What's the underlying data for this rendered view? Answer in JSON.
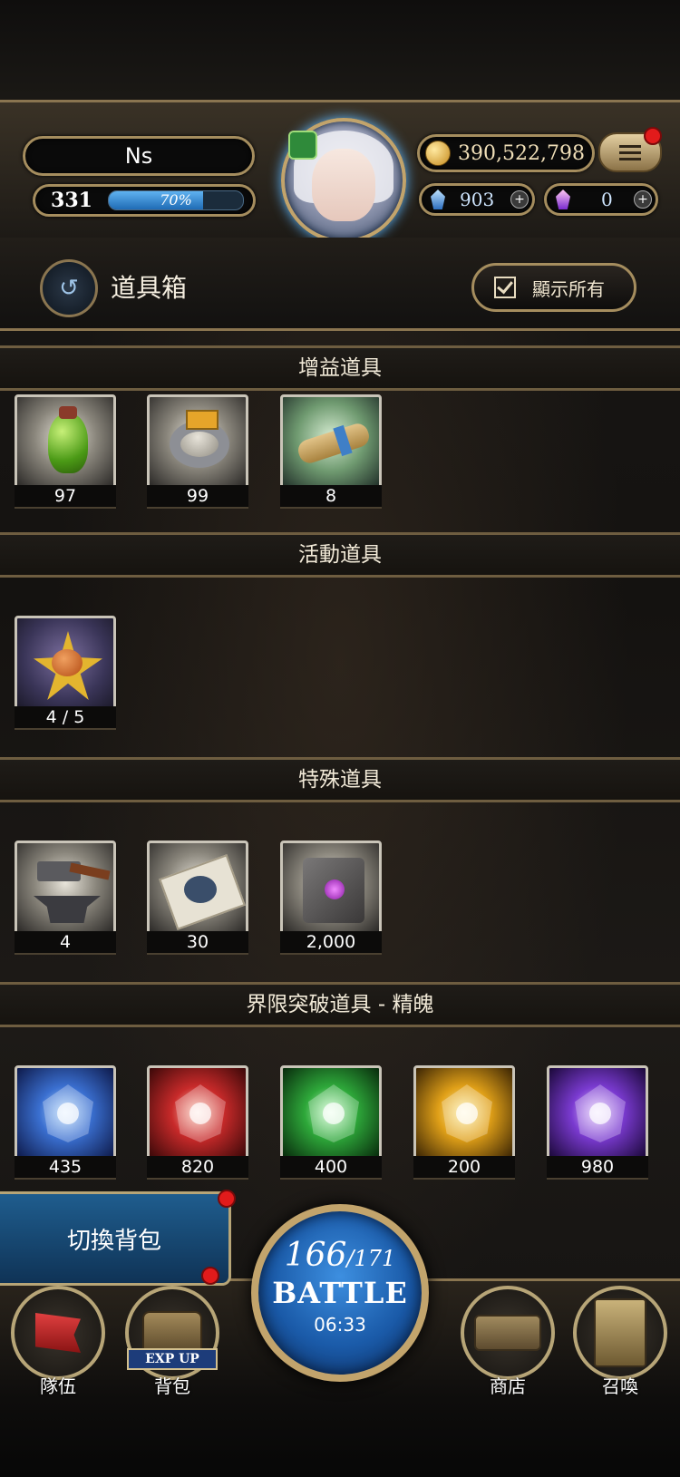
{
  "player": {
    "name": "Ns",
    "level": "331",
    "exp_text": "70%",
    "exp_percent": 70
  },
  "currency": {
    "gold": "390,522,798",
    "blue_gem": "903",
    "purple_gem": "0",
    "plus_symbol": "+"
  },
  "header": {
    "title": "道具箱",
    "show_all_label": "顯示所有",
    "back_icon": "↺"
  },
  "sections": [
    {
      "title": "增益道具",
      "items": [
        {
          "name": "green-potion-icon",
          "count": "97"
        },
        {
          "name": "silver-ring-icon",
          "count": "99"
        },
        {
          "name": "scroll-icon",
          "count": "8"
        }
      ]
    },
    {
      "title": "活動道具",
      "items": [
        {
          "name": "golden-star-icon",
          "count": "4 / 5"
        }
      ]
    },
    {
      "title": "特殊道具",
      "items": [
        {
          "name": "hammer-anvil-icon",
          "count": "4"
        },
        {
          "name": "ticket-icon",
          "count": "30"
        },
        {
          "name": "stone-cube-icon",
          "count": "2,000"
        }
      ]
    },
    {
      "title": "界限突破道具 - 精魄",
      "items": [
        {
          "name": "blue-essence-icon",
          "count": "435"
        },
        {
          "name": "red-essence-icon",
          "count": "820"
        },
        {
          "name": "green-essence-icon",
          "count": "400"
        },
        {
          "name": "yellow-essence-icon",
          "count": "200"
        },
        {
          "name": "purple-essence-icon",
          "count": "980"
        }
      ]
    }
  ],
  "bottom_nav": {
    "switch_bag": "切換背包",
    "team": "隊伍",
    "bag": "背包",
    "exp_up": "EXP UP",
    "shop": "商店",
    "summon": "召喚"
  },
  "battle": {
    "stamina_current": "166",
    "stamina_max": "/171",
    "label": "BATTLE",
    "timer": "06:33"
  },
  "colors": {
    "gold_trim": "#a58d5e",
    "notification_red": "#e21b1b",
    "exp_blue": "#5fb2f0"
  }
}
